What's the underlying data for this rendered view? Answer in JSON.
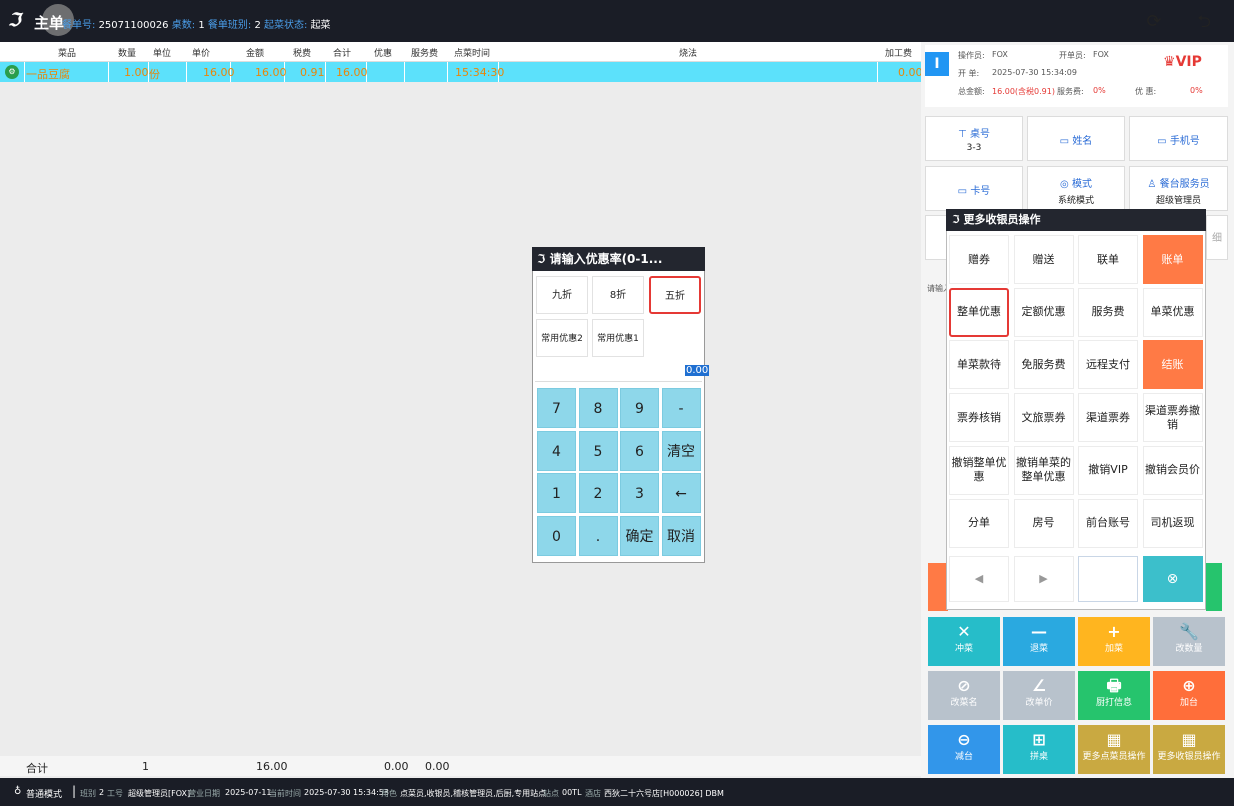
{
  "topbar": {
    "title": "主单",
    "order_no_label": "餐单号:",
    "order_no": "25071100026",
    "tables_label": "桌数:",
    "tables": "1",
    "shift_label": "餐单班别:",
    "shift": "2",
    "status_label": "起菜状态:",
    "status": "起菜"
  },
  "table": {
    "headers": [
      "菜品",
      "数量",
      "单位",
      "单价",
      "金额",
      "税费",
      "合计",
      "优惠",
      "服务费",
      "点菜时间",
      "烧法",
      "加工费"
    ],
    "row": {
      "dish": "一品豆腐",
      "qty": "1.00",
      "unit": "份",
      "price": "16.00",
      "amount": "16.00",
      "tax": "0.91",
      "total": "16.00",
      "time": "15:34:30",
      "processing": "0.00"
    }
  },
  "totals": {
    "label": "合计",
    "qty": "1",
    "amount": "16.00",
    "discount": "0.00",
    "service": "0.00"
  },
  "status_bar": {
    "mode": "普通模式",
    "shift_label": "班别",
    "shift": "2",
    "worker_label": "工号",
    "worker": "超级管理员[FOX]",
    "bizdate_label": "营业日期",
    "bizdate": "2025-07-11",
    "now_label": "当前时间",
    "now": "2025-07-30 15:34:53",
    "role_label": "角色",
    "role": "点菜员,收银员,稽核管理员,后厨,专用站点",
    "site_label": "站点",
    "site": "00TL",
    "store_label": "酒店",
    "store": "西狄二十六号店[H000026] DBM"
  },
  "order_info": {
    "badge": "I",
    "operator_label": "操作员:",
    "operator": "FOX",
    "opener_label": "开单员:",
    "opener": "FOX",
    "open_label": "开 单:",
    "open_time": "2025-07-30 15:34:09",
    "total_label": "总金额:",
    "total": "16.00(含税0.91)",
    "service_label": "服务费:",
    "service": "0%",
    "discount_label": "优 惠:",
    "discount": "0%",
    "vip": "VIP"
  },
  "info_buttons": [
    {
      "label": "桌号",
      "sub": "3-3"
    },
    {
      "label": "姓名",
      "sub": ""
    },
    {
      "label": "手机号",
      "sub": ""
    },
    {
      "label": "卡号",
      "sub": ""
    },
    {
      "label": "模式",
      "sub": "系统模式"
    },
    {
      "label": "餐台服务员",
      "sub": "超级管理员"
    }
  ],
  "partial_text": "请输入",
  "partial_right": "细",
  "more_ops": {
    "title": "更多收银员操作",
    "buttons": [
      "赠券",
      "赠送",
      "联单",
      "账单",
      "整单优惠",
      "定额优惠",
      "服务费",
      "单菜优惠",
      "单菜款待",
      "免服务费",
      "远程支付",
      "结账",
      "票券核销",
      "文旅票券",
      "渠道票券",
      "渠道票券撤销",
      "撤销整单优惠",
      "撤销单菜的整单优惠",
      "撤销VIP",
      "撤销会员价",
      "分单",
      "房号",
      "前台账号",
      "司机返现"
    ]
  },
  "action_buttons": [
    {
      "label": "冲菜",
      "icon": "✕"
    },
    {
      "label": "退菜",
      "icon": "—"
    },
    {
      "label": "加菜",
      "icon": "+"
    },
    {
      "label": "改数量",
      "icon": "🔧"
    },
    {
      "label": "改菜名",
      "icon": "⊘"
    },
    {
      "label": "改单价",
      "icon": "∠"
    },
    {
      "label": "厨打信息",
      "icon": "🖶"
    },
    {
      "label": "加台",
      "icon": "⊕"
    },
    {
      "label": "减台",
      "icon": "⊖"
    },
    {
      "label": "拼桌",
      "icon": "⊞"
    },
    {
      "label": "更多点菜员操作",
      "icon": "▦"
    },
    {
      "label": "更多收银员操作",
      "icon": "▦"
    }
  ],
  "discount_dialog": {
    "title": "请输入优惠率(0-1...",
    "quick": [
      "九折",
      "8折",
      "五折",
      "常用优惠2",
      "常用优惠1"
    ],
    "value": "0.00",
    "keys": [
      "7",
      "8",
      "9",
      "-",
      "4",
      "5",
      "6",
      "清空",
      "1",
      "2",
      "3",
      "←",
      "0",
      ".",
      "确定",
      "取消"
    ]
  }
}
